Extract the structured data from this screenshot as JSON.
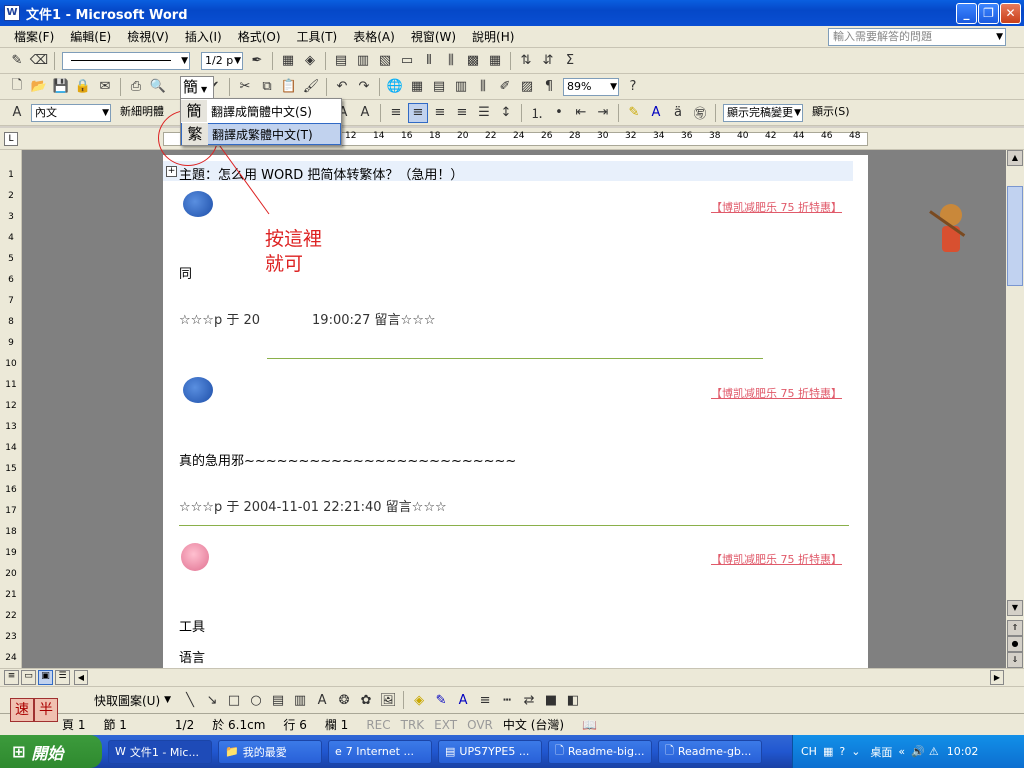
{
  "window": {
    "title": "文件1 - Microsoft Word",
    "icon_label": "W",
    "minimize": "_",
    "maximize": "❐",
    "close": "✕"
  },
  "menu": {
    "items": [
      "檔案(F)",
      "編輯(E)",
      "檢視(V)",
      "插入(I)",
      "格式(O)",
      "工具(T)",
      "表格(A)",
      "視窗(W)",
      "說明(H)"
    ],
    "help_placeholder": "輸入需要解答的問題"
  },
  "toolbar1": {
    "line_width": "1/2 p"
  },
  "toolbar2": {
    "jian_button": "簡",
    "zoom": "89%"
  },
  "toolbar3": {
    "style": "內文",
    "font": "新細明體",
    "view_mode": "顯示完稿變更",
    "show": "顯示(S)"
  },
  "dropdown": {
    "items": [
      {
        "icon": "簡",
        "label": "翻譯成簡體中文(S)"
      },
      {
        "icon": "繁",
        "label": "翻譯成繁體中文(T)"
      }
    ]
  },
  "ruler": {
    "ticks": [
      "12",
      "14",
      "16",
      "18",
      "20",
      "22",
      "24",
      "26",
      "28",
      "30",
      "32",
      "34",
      "36",
      "38",
      "40",
      "42",
      "44",
      "46",
      "48"
    ]
  },
  "vruler": {
    "ticks": [
      "1",
      "2",
      "3",
      "4",
      "5",
      "6",
      "7",
      "8",
      "9",
      "10",
      "11",
      "12",
      "13",
      "14",
      "15",
      "16",
      "17",
      "18",
      "19",
      "20",
      "21",
      "22",
      "23",
      "24"
    ]
  },
  "document": {
    "subject": "主題：怎么用 WORD 把简体转繁体？（急用！）",
    "ad_link": "【博凯减肥乐 75 折特惠】",
    "post1_text": "同",
    "post1_footer": "☆☆☆p 于 20　　　　19:00:27 留言☆☆☆",
    "post2_text": "真的急用邪~~~~~~~~~~~~~~~~~~~~~~~~~",
    "post2_footer": "☆☆☆p 于 2004-11-01 22:21:40 留言☆☆☆",
    "post3_line1": "工具",
    "post3_line2": "语言"
  },
  "annotation": {
    "text": "按這裡就可"
  },
  "drawbar": {
    "autoshapes": "快取圖案(U)"
  },
  "statusbar": {
    "page": "頁 1",
    "section": "節 1",
    "pages": "1/2",
    "at": "於 6.1cm",
    "line": "行 6",
    "col": "欄 1",
    "rec": "REC",
    "trk": "TRK",
    "ext": "EXT",
    "ovr": "OVR",
    "lang": "中文 (台灣)"
  },
  "ime": {
    "speed": "速",
    "half": "半"
  },
  "taskbar": {
    "start": "開始",
    "tasks": [
      "文件1 - Mic...",
      "我的最愛",
      "7 Internet ...",
      "UPS7YPE5 ...",
      "Readme-big...",
      "Readme-gb..."
    ],
    "lang": "CH",
    "desktop": "桌面",
    "clock": "10:02"
  }
}
